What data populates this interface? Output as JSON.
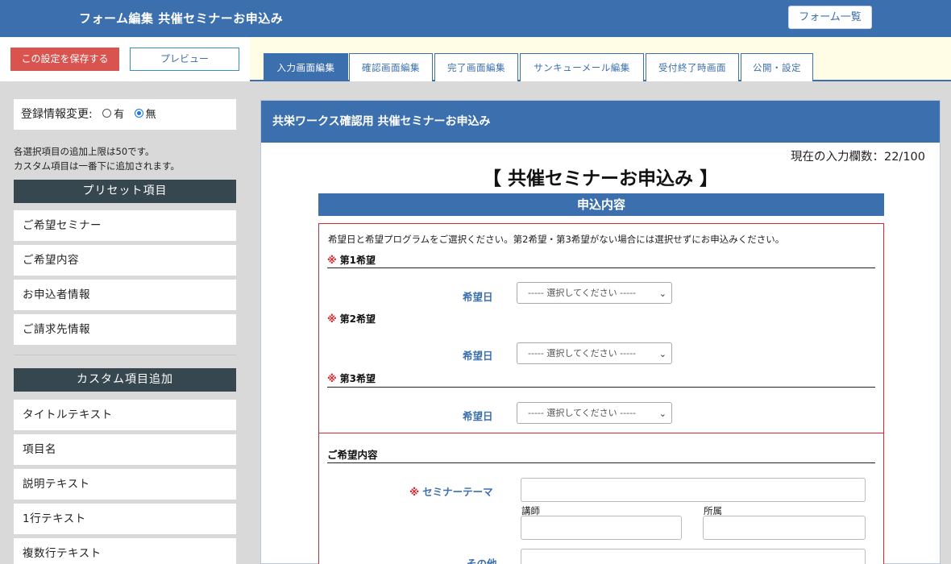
{
  "header": {
    "title": "フォーム編集 共催セミナーお申込み",
    "form_list_label": "フォーム一覧"
  },
  "actions": {
    "save_label": "この設定を保存する",
    "preview_label": "プレビュー"
  },
  "tabs": [
    {
      "label": "入力画面編集",
      "active": true
    },
    {
      "label": "確認画面編集",
      "active": false
    },
    {
      "label": "完了画面編集",
      "active": false
    },
    {
      "label": "サンキューメール編集",
      "active": false
    },
    {
      "label": "受付終了時画面",
      "active": false
    },
    {
      "label": "公開・設定",
      "active": false
    }
  ],
  "sidebar": {
    "registration_label": "登録情報変更:",
    "option_yes": "有",
    "option_no": "無",
    "selected": "無",
    "note_line1": "各選択項目の追加上限は50です。",
    "note_line2": "カスタム項目は一番下に追加されます。",
    "preset_heading": "プリセット項目",
    "preset_items": [
      "ご希望セミナー",
      "ご希望内容",
      "お申込者情報",
      "ご請求先情報"
    ],
    "custom_heading": "カスタム項目追加",
    "custom_items": [
      "タイトルテキスト",
      "項目名",
      "説明テキスト",
      "1行テキスト",
      "複数行テキスト"
    ]
  },
  "main": {
    "panel_title": "共栄ワークス確認用 共催セミナーお申込み",
    "field_count": "現在の入力欄数：22/100",
    "form_title": "【 共催セミナーお申込み 】",
    "section_bar": "申込内容",
    "instruction": "希望日と希望プログラムをご選択ください。第2希望・第3希望がない場合には選択せずにお申込みください。",
    "required_mark": "※",
    "preferences": [
      {
        "title": "第1希望",
        "field_label": "希望日",
        "placeholder": "----- 選択してください -----"
      },
      {
        "title": "第2希望",
        "field_label": "希望日",
        "placeholder": "----- 選択してください -----"
      },
      {
        "title": "第3希望",
        "field_label": "希望日",
        "placeholder": "----- 選択してください -----"
      }
    ],
    "content_section_title": "ご希望内容",
    "seminar_theme_label": "セミナーテーマ",
    "lecturer_label": "講師",
    "affiliation_label": "所属",
    "other_label": "その他"
  }
}
